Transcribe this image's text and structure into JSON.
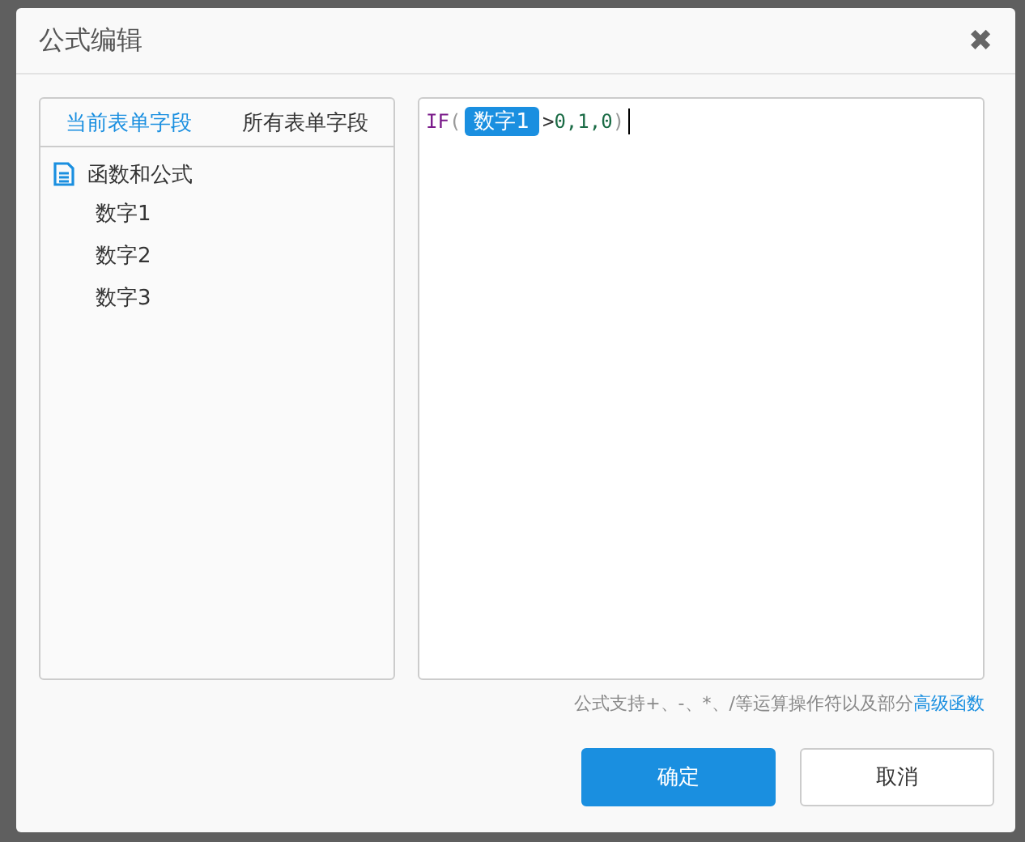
{
  "dialog": {
    "title": "公式编辑",
    "close": "✖"
  },
  "field_tabs": [
    {
      "label": "当前表单字段",
      "selected": true
    },
    {
      "label": "所有表单字段",
      "selected": false
    }
  ],
  "tree": {
    "label": "函数和公式",
    "children": [
      {
        "label": "数字1"
      },
      {
        "label": "数字2"
      },
      {
        "label": "数字3"
      }
    ]
  },
  "formula": [
    {
      "kind": "func",
      "text": "IF"
    },
    {
      "kind": "punct",
      "text": "("
    },
    {
      "kind": "field",
      "text": "数字1"
    },
    {
      "kind": "op",
      "text": ">"
    },
    {
      "kind": "num",
      "text": "0,1,0"
    },
    {
      "kind": "punct",
      "text": ")"
    }
  ],
  "hint": {
    "text": "公式支持+、-、*、/等运算操作符以及部分",
    "link": "高级函数"
  },
  "buttons": [
    {
      "label": "确定",
      "kind": "primary"
    },
    {
      "label": "取消",
      "kind": "default"
    }
  ]
}
